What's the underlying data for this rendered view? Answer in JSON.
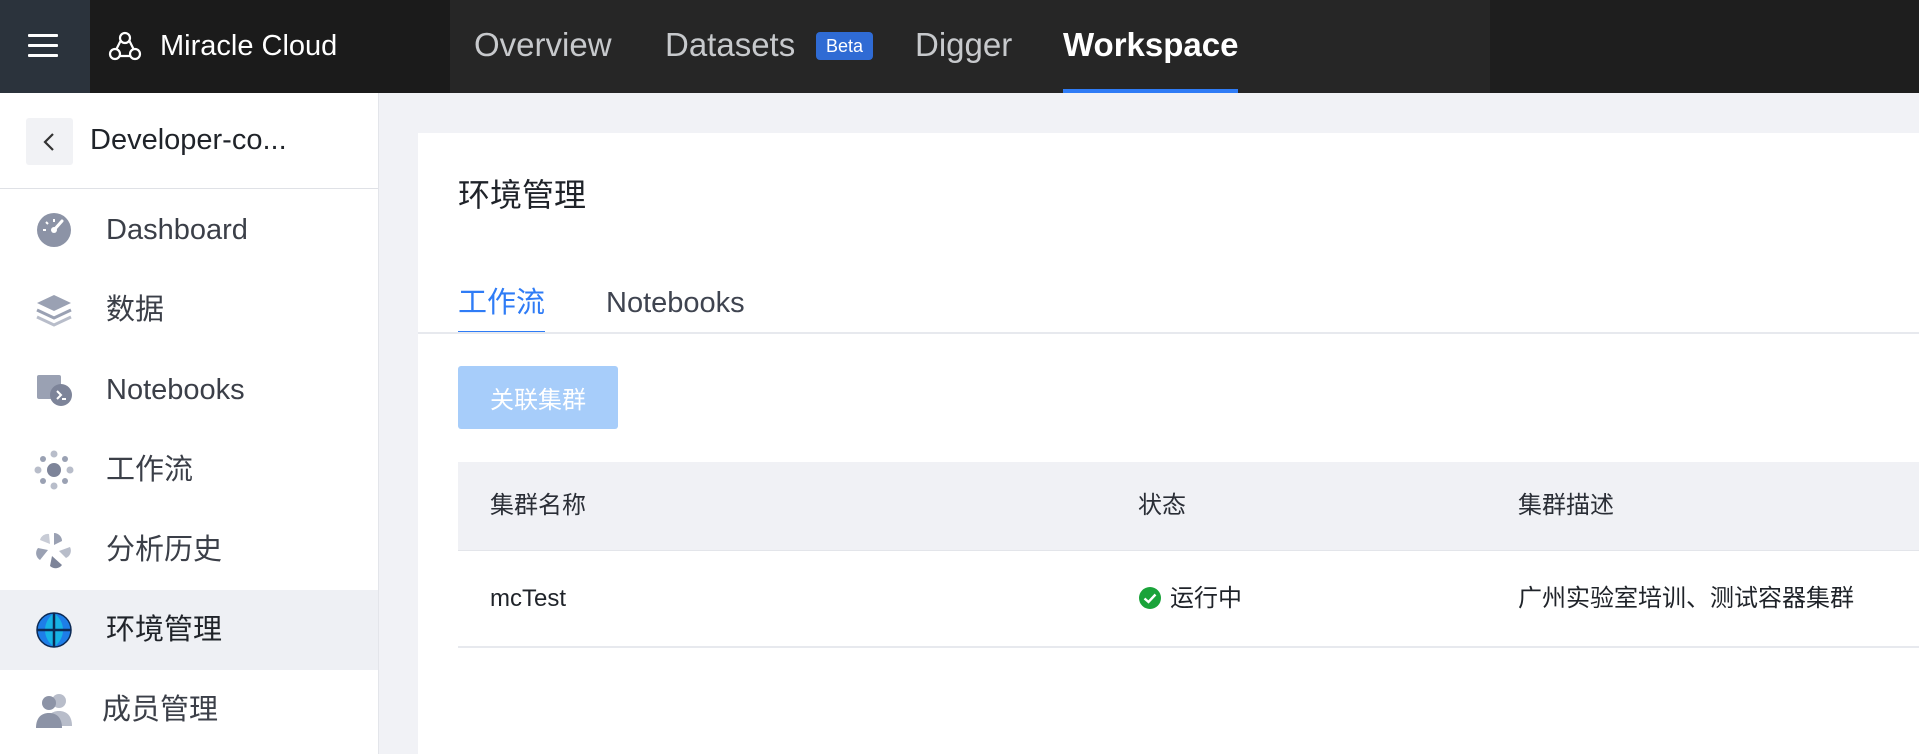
{
  "header": {
    "brand": "Miracle Cloud",
    "nav": [
      {
        "label": "Overview"
      },
      {
        "label": "Datasets",
        "badge": "Beta"
      },
      {
        "label": "Digger"
      },
      {
        "label": "Workspace",
        "active": true
      }
    ]
  },
  "sidebar": {
    "project_name": "Developer-co...",
    "items": [
      {
        "label": "Dashboard",
        "icon": "dashboard-icon"
      },
      {
        "label": "数据",
        "icon": "layers-icon"
      },
      {
        "label": "Notebooks",
        "icon": "notebook-icon"
      },
      {
        "label": "工作流",
        "icon": "workflow-icon"
      },
      {
        "label": "分析历史",
        "icon": "history-icon"
      },
      {
        "label": "环境管理",
        "icon": "globe-icon",
        "active": true
      },
      {
        "label": "成员管理",
        "icon": "members-icon"
      }
    ]
  },
  "main": {
    "title": "环境管理",
    "tabs": [
      {
        "label": "工作流",
        "active": true
      },
      {
        "label": "Notebooks"
      }
    ],
    "link_button": "关联集群",
    "table": {
      "columns": [
        "集群名称",
        "状态",
        "集群描述"
      ],
      "rows": [
        {
          "name": "mcTest",
          "status": "运行中",
          "description": "广州实验室培训、测试容器集群"
        }
      ]
    }
  },
  "colors": {
    "accent": "#2f7cf6",
    "status_running": "#1aa33a",
    "topbar_bg": "#1e1e1e"
  }
}
